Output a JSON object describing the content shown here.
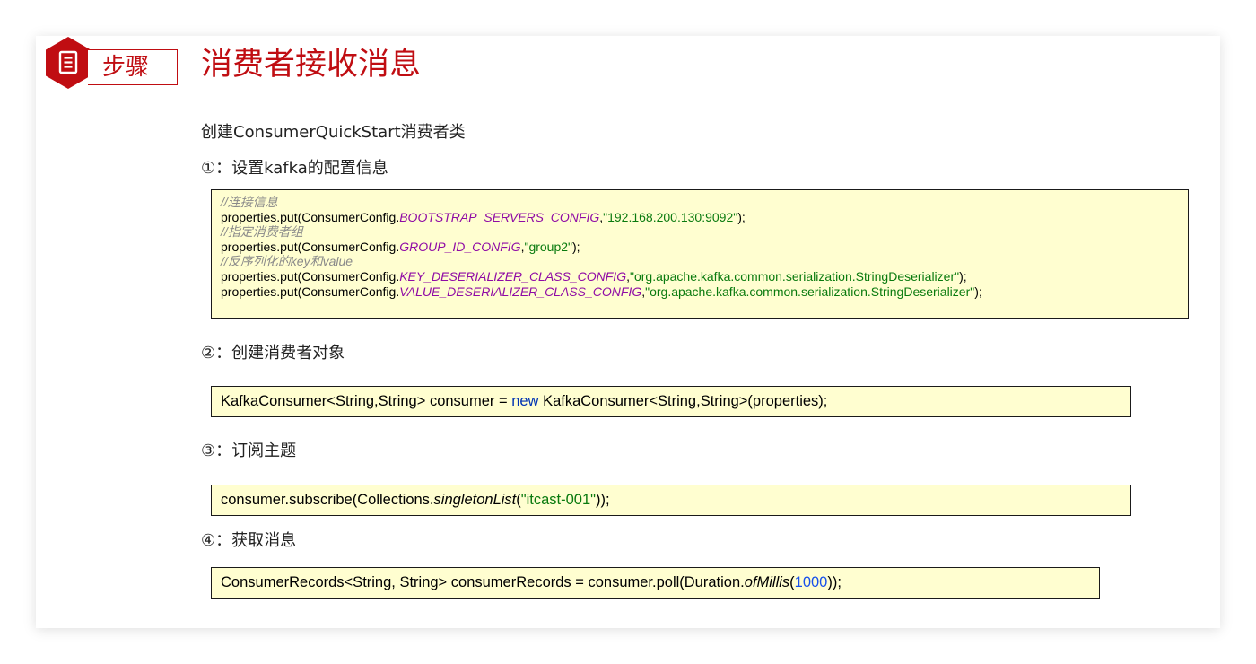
{
  "header": {
    "tag_label": "步骤",
    "tag_icon": "document-icon",
    "title": "消费者接收消息",
    "accent_color": "#c00d12"
  },
  "intro": "创建ConsumerQuickStart消费者类",
  "steps": [
    {
      "heading": "①：设置kafka的配置信息",
      "code": {
        "comment1": "//连接信息",
        "line1_pre": "properties.put(ConsumerConfig.",
        "line1_const": "BOOTSTRAP_SERVERS_CONFIG",
        "line1_sep": ",",
        "line1_str": "\"192.168.200.130:9092\"",
        "line1_post": ");",
        "comment2": "//指定消费者组",
        "line2_pre": "properties.put(ConsumerConfig.",
        "line2_const": "GROUP_ID_CONFIG",
        "line2_sep": ",",
        "line2_str": "\"group2\"",
        "line2_post": ");",
        "comment3": "//反序列化的key和value",
        "line3_pre": "properties.put(ConsumerConfig.",
        "line3_const": "KEY_DESERIALIZER_CLASS_CONFIG",
        "line3_sep": ",",
        "line3_str": "\"org.apache.kafka.common.serialization.StringDeserializer\"",
        "line3_post": ");",
        "line4_pre": "properties.put(ConsumerConfig.",
        "line4_const": "VALUE_DESERIALIZER_CLASS_CONFIG",
        "line4_sep": ",",
        "line4_str": "\"org.apache.kafka.common.serialization.StringDeserializer\"",
        "line4_post": ");"
      }
    },
    {
      "heading": "②：创建消费者对象",
      "code": {
        "pre": "KafkaConsumer<String,String> consumer = ",
        "kw": "new",
        "post": " KafkaConsumer<String,String>(properties);"
      }
    },
    {
      "heading": "③：订阅主题",
      "code": {
        "pre": "consumer.subscribe(Collections.",
        "fn": "singletonList",
        "open": "(",
        "str": "\"itcast-001\"",
        "post": "));"
      }
    },
    {
      "heading": "④：获取消息",
      "code": {
        "pre": "ConsumerRecords<String, String> consumerRecords = consumer.poll(Duration.",
        "fn": "ofMillis",
        "open": "(",
        "num": "1000",
        "post": "));"
      }
    }
  ]
}
